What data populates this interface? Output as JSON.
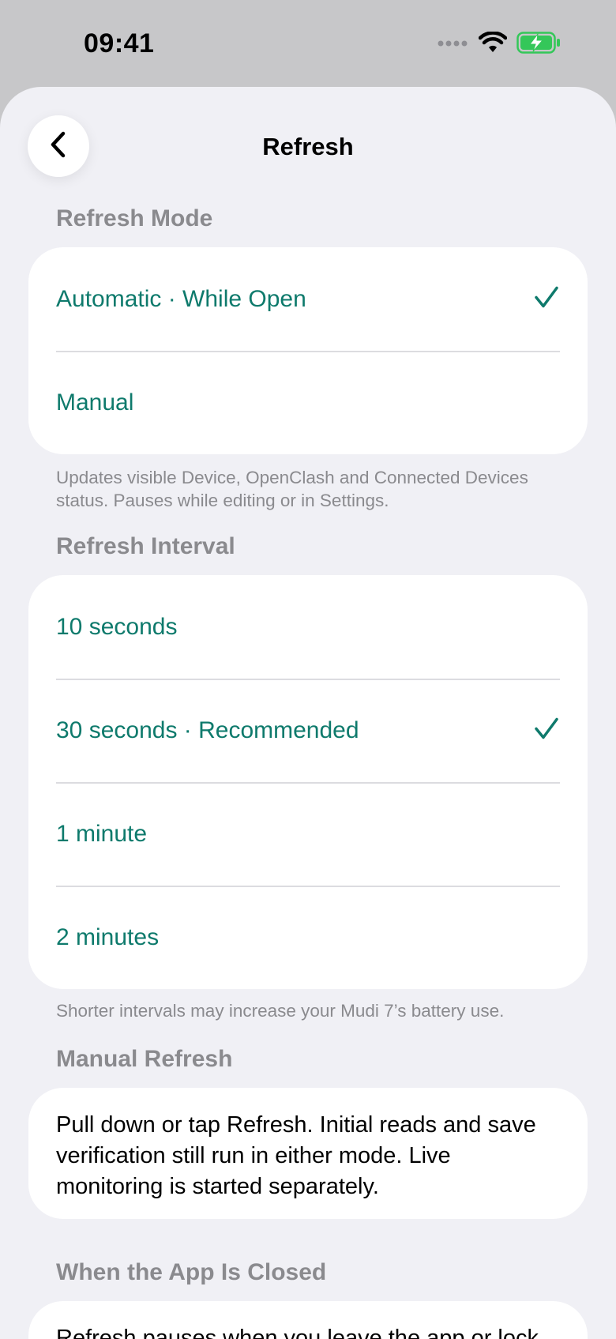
{
  "status_bar": {
    "time": "09:41",
    "icons": [
      "signal-dots-icon",
      "wifi-icon",
      "battery-charging-icon"
    ],
    "battery_color": "#34c759"
  },
  "nav": {
    "title": "Refresh",
    "back_icon": "chevron-left-icon"
  },
  "colors": {
    "accent": "#0e7a6c",
    "background": "#f0f0f5",
    "secondary_text": "#8a8a8e"
  },
  "refresh_mode": {
    "header": "Refresh Mode",
    "options": [
      {
        "label": "Automatic · While Open",
        "selected": true
      },
      {
        "label": "Manual",
        "selected": false
      }
    ],
    "footnote": "Updates visible Device, OpenClash and Connected Devices status. Pauses while editing or in Settings."
  },
  "refresh_interval": {
    "header": "Refresh Interval",
    "options": [
      {
        "label": "10 seconds",
        "selected": false
      },
      {
        "label": "30 seconds · Recommended",
        "selected": true
      },
      {
        "label": "1 minute",
        "selected": false
      },
      {
        "label": "2 minutes",
        "selected": false
      }
    ],
    "footnote": "Shorter intervals may increase your Mudi 7’s battery use."
  },
  "manual_refresh": {
    "header": "Manual Refresh",
    "text": "Pull down or tap Refresh. Initial reads and save verification still run in either mode. Live monitoring is started separately."
  },
  "app_closed": {
    "header": "When the App Is Closed",
    "text": "Refresh pauses when you leave the app or lock"
  }
}
